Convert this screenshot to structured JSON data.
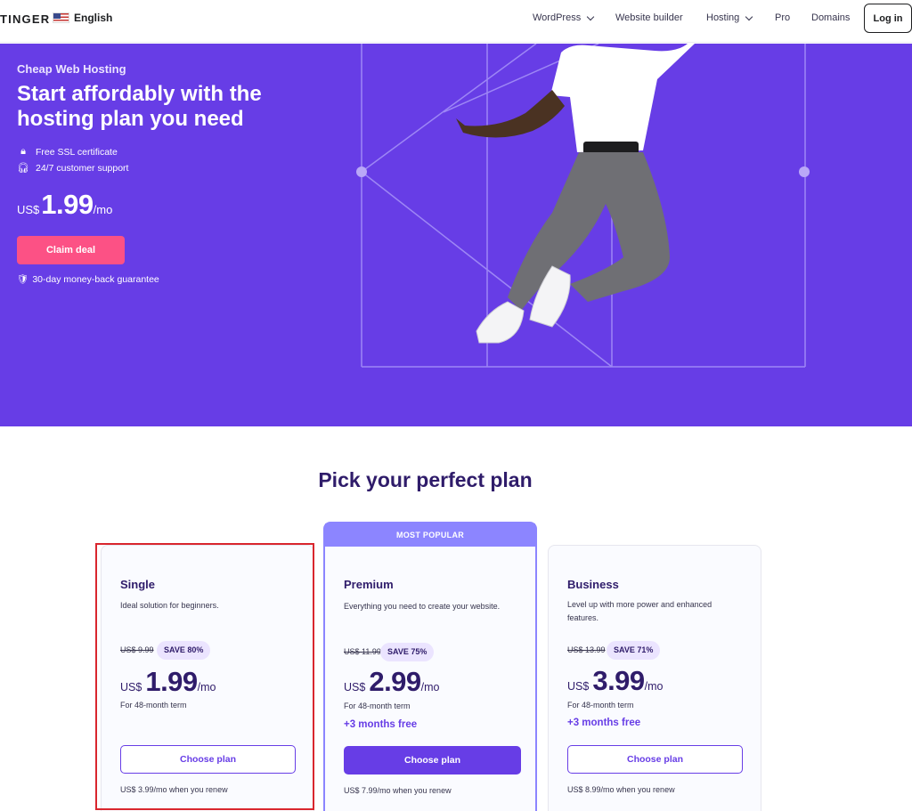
{
  "header": {
    "brand": "TINGER",
    "language": "English",
    "nav": [
      {
        "label": "WordPress",
        "dropdown": true
      },
      {
        "label": "Website builder",
        "dropdown": false
      },
      {
        "label": "Hosting",
        "dropdown": true
      },
      {
        "label": "Pro",
        "dropdown": false
      },
      {
        "label": "Domains",
        "dropdown": false
      }
    ],
    "login_label": "Log in"
  },
  "hero": {
    "eyebrow": "Cheap Web Hosting",
    "title": "Start affordably with the hosting plan you need",
    "features": [
      "Free SSL certificate",
      "24/7 customer support"
    ],
    "price": {
      "currency": "US$",
      "amount": "1.99",
      "period": "/mo"
    },
    "cta_label": "Claim deal",
    "guarantee": "30-day money-back guarantee",
    "background_color": "#673de6"
  },
  "plans": {
    "title": "Pick your perfect plan",
    "popular_badge": "MOST POPULAR",
    "cards": [
      {
        "name": "Single",
        "description": "Ideal solution for beginners.",
        "old_price": "US$ 9.99",
        "save": "SAVE 80%",
        "currency": "US$",
        "amount": "1.99",
        "period": "/mo",
        "term": "For 48-month term",
        "bonus": "",
        "button": "Choose plan",
        "renew": "US$ 3.99/mo when you renew"
      },
      {
        "name": "Premium",
        "description": "Everything you need to create your website.",
        "old_price": "US$ 11.99",
        "save": "SAVE 75%",
        "currency": "US$",
        "amount": "2.99",
        "period": "/mo",
        "term": "For 48-month term",
        "bonus": "+3 months free",
        "button": "Choose plan",
        "renew": "US$ 7.99/mo when you renew"
      },
      {
        "name": "Business",
        "description": "Level up with more power and enhanced features.",
        "old_price": "US$ 13.99",
        "save": "SAVE 71%",
        "currency": "US$",
        "amount": "3.99",
        "period": "/mo",
        "term": "For 48-month term",
        "bonus": "+3 months free",
        "button": "Choose plan",
        "renew": "US$ 8.99/mo when you renew"
      }
    ]
  },
  "colors": {
    "accent": "#673de6",
    "cta_pink": "#fc5185",
    "popular": "#8c85ff",
    "heading": "#2f1c6a",
    "highlight": "#d9262e"
  }
}
